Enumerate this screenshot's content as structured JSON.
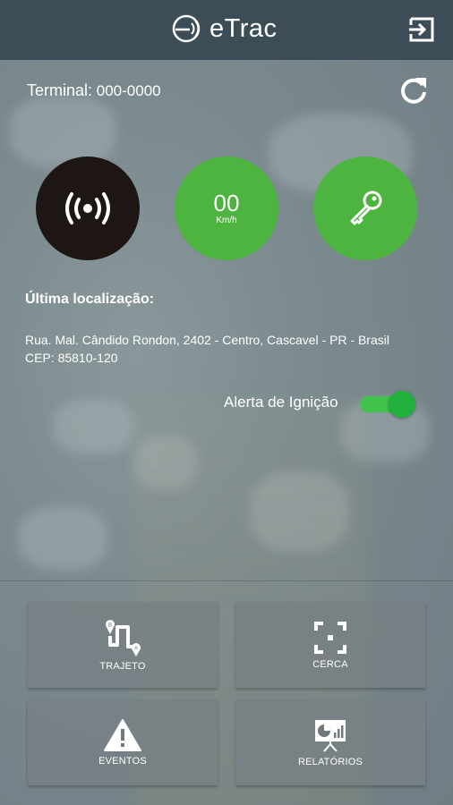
{
  "header": {
    "app_name": "eTrac",
    "logo_icon": "etrac-logo-icon",
    "logout_icon": "logout-icon"
  },
  "terminal": {
    "label": "Terminal:",
    "value": "000-0000",
    "refresh_icon": "refresh-icon"
  },
  "status": {
    "signal_icon": "signal-broadcast-icon",
    "speed_value": "00",
    "speed_unit": "Km/h",
    "ignition_icon": "key-icon"
  },
  "location": {
    "title": "Última localização:",
    "address_line1": "Rua. Mal. Cândido Rondon, 2402 - Centro, Cascavel - PR - Brasil",
    "address_line2": "CEP: 85810-120"
  },
  "ignition_alert": {
    "label": "Alerta de Ignição",
    "enabled": true
  },
  "menu": [
    {
      "label": "TRAJETO",
      "icon": "route-icon"
    },
    {
      "label": "CERCA",
      "icon": "fence-icon"
    },
    {
      "label": "EVENTOS",
      "icon": "warning-icon"
    },
    {
      "label": "RELATÓRIOS",
      "icon": "report-icon"
    }
  ],
  "colors": {
    "header": "#3c4d57",
    "green": "#4db53f",
    "dark_circle": "#1e1612",
    "toggle_on": "#21b13c"
  }
}
